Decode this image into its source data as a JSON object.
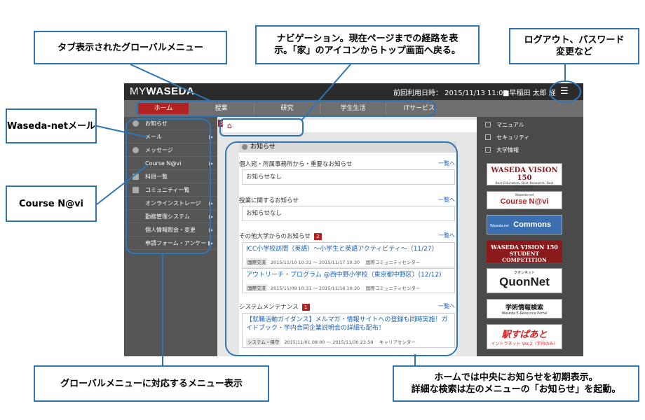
{
  "app": {
    "logo_prefix": "MY",
    "logo_main": "WASEDA",
    "last_login": "前回利用日時： 2015/11/13 11:07",
    "user": "早稲田 太郎 経",
    "menu_icon": "list-icon"
  },
  "global_menu": [
    "ホーム",
    "授業",
    "研究",
    "学生生活",
    "ITサービス"
  ],
  "side_menu": [
    {
      "label": "お知らせ",
      "arrow": false,
      "icon": true
    },
    {
      "label": "メール",
      "arrow": true,
      "icon": false
    },
    {
      "label": "メッセージ",
      "arrow": false,
      "icon": true
    },
    {
      "label": "Course N@vi",
      "arrow": true,
      "icon": false
    },
    {
      "label": "科目一覧",
      "arrow": false,
      "icon": true
    },
    {
      "label": "コミュニティ一覧",
      "arrow": false,
      "icon": true
    },
    {
      "label": "オンラインストレージ",
      "arrow": true,
      "icon": false
    },
    {
      "label": "勤務管理システム",
      "arrow": true,
      "icon": false
    },
    {
      "label": "個人情報照会・変更",
      "arrow": true,
      "icon": false
    },
    {
      "label": "申請フォーム・アンケート",
      "arrow": true,
      "icon": false
    }
  ],
  "notice_badge": "3",
  "notice": {
    "title": "お知らせ",
    "sec1": {
      "heading": "個人宛・所属事務所から・重要なお知らせ",
      "more": "一覧へ",
      "empty": "お知らせなし"
    },
    "sec2": {
      "heading": "授業に関するお知らせ",
      "more": "一覧へ",
      "empty": "お知らせなし"
    },
    "sec3": {
      "heading": "その他大学からのお知らせ",
      "badge": "2",
      "more": "一覧へ",
      "items": [
        {
          "title": "ICC小学校訪問（英語）～小学生と英語アクティビティ～（11/27）",
          "tag": "国際交流",
          "meta": "2015/11/10 10:31 ～ 2015/11/17 10:30　 国際コミュニティセンター"
        },
        {
          "title": "アウトリーチ・プログラム @西中野小学校（東京都中野区）(12/12)",
          "tag": "国際交流",
          "meta": "2015/11/09 10:31 ～ 2015/11/16 10:30　 国際コミュニティセンター"
        }
      ]
    },
    "sec4": {
      "heading": "システムメンテナンス",
      "badge": "1",
      "more": "一覧へ",
      "items": [
        {
          "title": "【就職活動ガイダンス】メルマガ・情報サイトへの登録も同時実施！ガイドブック・学内合同企業説明会の詳細も配布！",
          "tag": "システム・保守",
          "meta": "2015/11/01 08:00 ～ 2015/11/30 23:59　 キャリアセンター"
        }
      ]
    }
  },
  "right_links": [
    "マニュアル",
    "セキュリティ",
    "大学情報"
  ],
  "banners": {
    "vision": {
      "title": "WASEDA VISION 150",
      "sub": "Best Education, Best Research, Best Community"
    },
    "coursenavi": {
      "small": "Waseda-net",
      "main": "Course N@vi"
    },
    "commons": {
      "small": "Waseda-net",
      "main": "Commons"
    },
    "competition": {
      "line1": "WASEDA VISION 150",
      "line2": "STUDENT COMPETITION"
    },
    "quon": {
      "small": "クオンネット",
      "main": "QuonNet"
    },
    "eresource": {
      "main": "学術情報検索",
      "sub": "Waseda E-Resource Portal"
    },
    "ekisupo": {
      "main": "駅すぱあと",
      "sub": "イントラネット Ver.2（学内のみ）"
    }
  },
  "annotations": {
    "tabs": "タブ表示されたグローバルメニュー",
    "nav_line1": "ナビゲーション。現在ページまでの経路を表",
    "nav_line2": "示。「家」のアイコンからトップ画面へ戻る。",
    "logout_line1": "ログアウト、パスワード",
    "logout_line2": "変更など",
    "mail": "Waseda-netメール",
    "coursenavi": "Course N@vi",
    "side": "グローバルメニューに対応するメニュー表示",
    "home_line1": "ホームでは中央にお知らせを初期表示。",
    "home_line2": "詳細な検索は左のメニューの「お知らせ」を起動。"
  }
}
